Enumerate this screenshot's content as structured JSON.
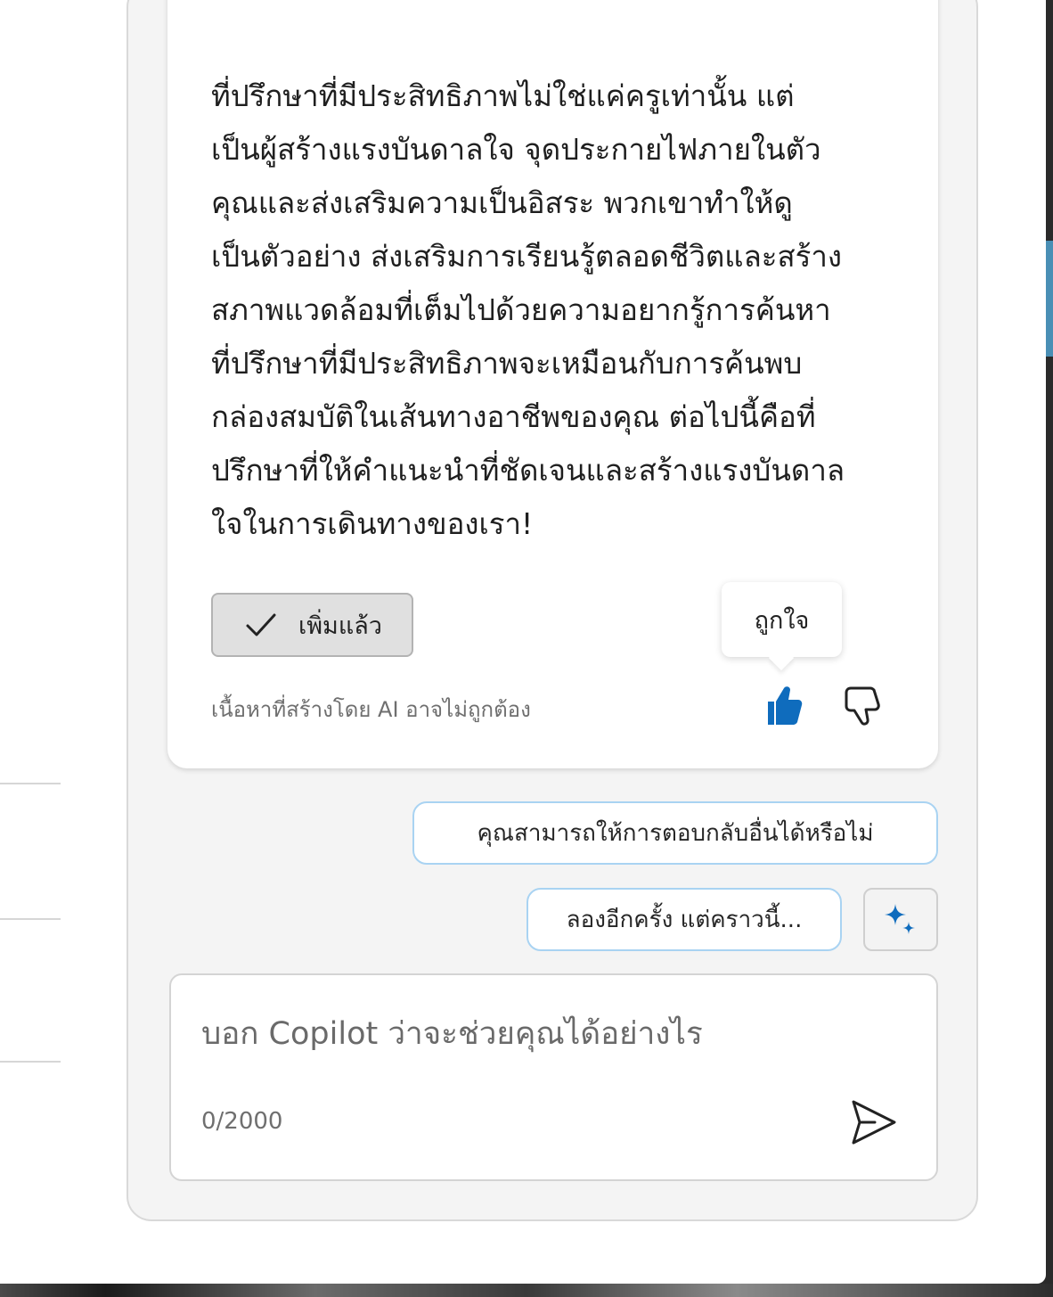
{
  "response": {
    "text": "ที่ปรึกษาที่มีประสิทธิภาพไม่ใช่แค่ครูเท่านั้น แต่\nเป็นผู้สร้างแรงบันดาลใจ จุดประกายไฟภายในตัว\nคุณและส่งเสริมความเป็นอิสระ พวกเขาทำให้ดู\nเป็นตัวอย่าง ส่งเสริมการเรียนรู้ตลอดชีวิตและสร้าง\nสภาพแวดล้อมที่เต็มไปด้วยความอยากรู้การค้นหา\nที่ปรึกษาที่มีประสิทธิภาพจะเหมือนกับการค้นพบ\nกล่องสมบัติในเส้นทางอาชีพของคุณ ต่อไปนี้คือที่\nปรึกษาที่ให้คำแนะนำที่ชัดเจนและสร้างแรงบันดาล\nใจในการเดินทางของเรา!",
    "added_label": "เพิ่มแล้ว",
    "disclaimer": "เนื้อหาที่สร้างโดย AI อาจไม่ถูกต้อง",
    "like_tooltip": "ถูกใจ"
  },
  "suggestions": [
    "คุณสามารถให้การตอบกลับอื่นได้หรือไม่",
    "ลองอีกครั้ง แต่คราวนี้..."
  ],
  "composer": {
    "placeholder": "บอก Copilot ว่าจะช่วยคุณได้อย่างไร",
    "char_count": "0/2000"
  },
  "colors": {
    "accent": "#0f6cbd",
    "suggestion_border": "#a9d3f2",
    "panel_bg": "#f4f4f4"
  },
  "icons": {
    "added": "checkmark-icon",
    "like": "thumbs-up-icon",
    "dislike": "thumbs-down-icon",
    "sparkle": "sparkle-icon",
    "send": "send-icon"
  }
}
